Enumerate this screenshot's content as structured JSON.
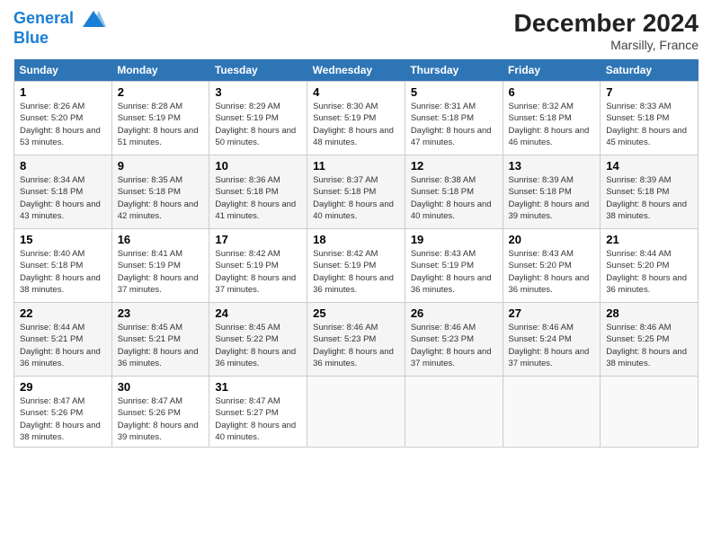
{
  "header": {
    "logo_line1": "General",
    "logo_line2": "Blue",
    "month": "December 2024",
    "location": "Marsilly, France"
  },
  "weekdays": [
    "Sunday",
    "Monday",
    "Tuesday",
    "Wednesday",
    "Thursday",
    "Friday",
    "Saturday"
  ],
  "weeks": [
    [
      {
        "day": "1",
        "sunrise": "Sunrise: 8:26 AM",
        "sunset": "Sunset: 5:20 PM",
        "daylight": "Daylight: 8 hours and 53 minutes."
      },
      {
        "day": "2",
        "sunrise": "Sunrise: 8:28 AM",
        "sunset": "Sunset: 5:19 PM",
        "daylight": "Daylight: 8 hours and 51 minutes."
      },
      {
        "day": "3",
        "sunrise": "Sunrise: 8:29 AM",
        "sunset": "Sunset: 5:19 PM",
        "daylight": "Daylight: 8 hours and 50 minutes."
      },
      {
        "day": "4",
        "sunrise": "Sunrise: 8:30 AM",
        "sunset": "Sunset: 5:19 PM",
        "daylight": "Daylight: 8 hours and 48 minutes."
      },
      {
        "day": "5",
        "sunrise": "Sunrise: 8:31 AM",
        "sunset": "Sunset: 5:18 PM",
        "daylight": "Daylight: 8 hours and 47 minutes."
      },
      {
        "day": "6",
        "sunrise": "Sunrise: 8:32 AM",
        "sunset": "Sunset: 5:18 PM",
        "daylight": "Daylight: 8 hours and 46 minutes."
      },
      {
        "day": "7",
        "sunrise": "Sunrise: 8:33 AM",
        "sunset": "Sunset: 5:18 PM",
        "daylight": "Daylight: 8 hours and 45 minutes."
      }
    ],
    [
      {
        "day": "8",
        "sunrise": "Sunrise: 8:34 AM",
        "sunset": "Sunset: 5:18 PM",
        "daylight": "Daylight: 8 hours and 43 minutes."
      },
      {
        "day": "9",
        "sunrise": "Sunrise: 8:35 AM",
        "sunset": "Sunset: 5:18 PM",
        "daylight": "Daylight: 8 hours and 42 minutes."
      },
      {
        "day": "10",
        "sunrise": "Sunrise: 8:36 AM",
        "sunset": "Sunset: 5:18 PM",
        "daylight": "Daylight: 8 hours and 41 minutes."
      },
      {
        "day": "11",
        "sunrise": "Sunrise: 8:37 AM",
        "sunset": "Sunset: 5:18 PM",
        "daylight": "Daylight: 8 hours and 40 minutes."
      },
      {
        "day": "12",
        "sunrise": "Sunrise: 8:38 AM",
        "sunset": "Sunset: 5:18 PM",
        "daylight": "Daylight: 8 hours and 40 minutes."
      },
      {
        "day": "13",
        "sunrise": "Sunrise: 8:39 AM",
        "sunset": "Sunset: 5:18 PM",
        "daylight": "Daylight: 8 hours and 39 minutes."
      },
      {
        "day": "14",
        "sunrise": "Sunrise: 8:39 AM",
        "sunset": "Sunset: 5:18 PM",
        "daylight": "Daylight: 8 hours and 38 minutes."
      }
    ],
    [
      {
        "day": "15",
        "sunrise": "Sunrise: 8:40 AM",
        "sunset": "Sunset: 5:18 PM",
        "daylight": "Daylight: 8 hours and 38 minutes."
      },
      {
        "day": "16",
        "sunrise": "Sunrise: 8:41 AM",
        "sunset": "Sunset: 5:19 PM",
        "daylight": "Daylight: 8 hours and 37 minutes."
      },
      {
        "day": "17",
        "sunrise": "Sunrise: 8:42 AM",
        "sunset": "Sunset: 5:19 PM",
        "daylight": "Daylight: 8 hours and 37 minutes."
      },
      {
        "day": "18",
        "sunrise": "Sunrise: 8:42 AM",
        "sunset": "Sunset: 5:19 PM",
        "daylight": "Daylight: 8 hours and 36 minutes."
      },
      {
        "day": "19",
        "sunrise": "Sunrise: 8:43 AM",
        "sunset": "Sunset: 5:19 PM",
        "daylight": "Daylight: 8 hours and 36 minutes."
      },
      {
        "day": "20",
        "sunrise": "Sunrise: 8:43 AM",
        "sunset": "Sunset: 5:20 PM",
        "daylight": "Daylight: 8 hours and 36 minutes."
      },
      {
        "day": "21",
        "sunrise": "Sunrise: 8:44 AM",
        "sunset": "Sunset: 5:20 PM",
        "daylight": "Daylight: 8 hours and 36 minutes."
      }
    ],
    [
      {
        "day": "22",
        "sunrise": "Sunrise: 8:44 AM",
        "sunset": "Sunset: 5:21 PM",
        "daylight": "Daylight: 8 hours and 36 minutes."
      },
      {
        "day": "23",
        "sunrise": "Sunrise: 8:45 AM",
        "sunset": "Sunset: 5:21 PM",
        "daylight": "Daylight: 8 hours and 36 minutes."
      },
      {
        "day": "24",
        "sunrise": "Sunrise: 8:45 AM",
        "sunset": "Sunset: 5:22 PM",
        "daylight": "Daylight: 8 hours and 36 minutes."
      },
      {
        "day": "25",
        "sunrise": "Sunrise: 8:46 AM",
        "sunset": "Sunset: 5:23 PM",
        "daylight": "Daylight: 8 hours and 36 minutes."
      },
      {
        "day": "26",
        "sunrise": "Sunrise: 8:46 AM",
        "sunset": "Sunset: 5:23 PM",
        "daylight": "Daylight: 8 hours and 37 minutes."
      },
      {
        "day": "27",
        "sunrise": "Sunrise: 8:46 AM",
        "sunset": "Sunset: 5:24 PM",
        "daylight": "Daylight: 8 hours and 37 minutes."
      },
      {
        "day": "28",
        "sunrise": "Sunrise: 8:46 AM",
        "sunset": "Sunset: 5:25 PM",
        "daylight": "Daylight: 8 hours and 38 minutes."
      }
    ],
    [
      {
        "day": "29",
        "sunrise": "Sunrise: 8:47 AM",
        "sunset": "Sunset: 5:26 PM",
        "daylight": "Daylight: 8 hours and 38 minutes."
      },
      {
        "day": "30",
        "sunrise": "Sunrise: 8:47 AM",
        "sunset": "Sunset: 5:26 PM",
        "daylight": "Daylight: 8 hours and 39 minutes."
      },
      {
        "day": "31",
        "sunrise": "Sunrise: 8:47 AM",
        "sunset": "Sunset: 5:27 PM",
        "daylight": "Daylight: 8 hours and 40 minutes."
      },
      null,
      null,
      null,
      null
    ]
  ]
}
